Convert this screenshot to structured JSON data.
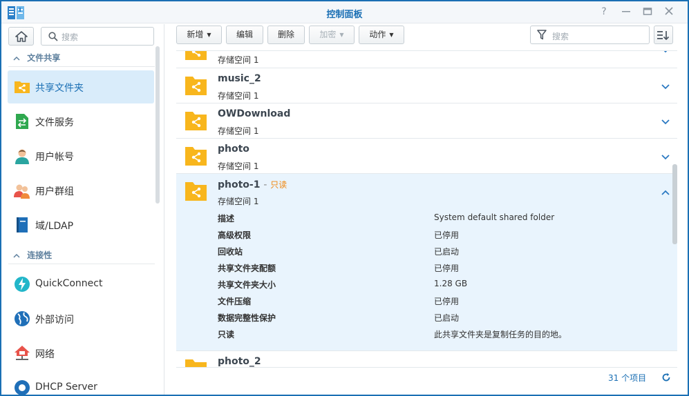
{
  "window": {
    "title": "控制面板"
  },
  "sidebar": {
    "search_placeholder": "搜索",
    "sections": [
      {
        "title": "文件共享"
      },
      {
        "title": "连接性"
      }
    ],
    "items": [
      {
        "label": "共享文件夹",
        "icon": "shared-folder-icon"
      },
      {
        "label": "文件服务",
        "icon": "file-services-icon"
      },
      {
        "label": "用户帐号",
        "icon": "user-icon"
      },
      {
        "label": "用户群组",
        "icon": "group-icon"
      },
      {
        "label": "域/LDAP",
        "icon": "domain-ldap-icon"
      },
      {
        "label": "QuickConnect",
        "icon": "quickconnect-icon"
      },
      {
        "label": "外部访问",
        "icon": "external-access-icon"
      },
      {
        "label": "网络",
        "icon": "network-icon"
      },
      {
        "label": "DHCP Server",
        "icon": "dhcp-server-icon"
      }
    ]
  },
  "toolbar": {
    "create": "新增",
    "edit": "编辑",
    "delete": "删除",
    "encrypt": "加密",
    "action": "动作",
    "filter_placeholder": "搜索"
  },
  "folders": [
    {
      "name": "",
      "volume": "存储空间 1"
    },
    {
      "name": "music_2",
      "volume": "存储空间 1"
    },
    {
      "name": "OWDownload",
      "volume": "存储空间 1"
    },
    {
      "name": "photo",
      "volume": "存储空间 1"
    },
    {
      "name": "photo-1",
      "volume": "存储空间 1",
      "readonly": "只读",
      "dash": "-"
    },
    {
      "name": "photo_2",
      "volume": ""
    }
  ],
  "details": [
    {
      "key": "描述",
      "value": "System default shared folder"
    },
    {
      "key": "高级权限",
      "value": "已停用"
    },
    {
      "key": "回收站",
      "value": "已启动"
    },
    {
      "key": "共享文件夹配额",
      "value": "已停用"
    },
    {
      "key": "共享文件夹大小",
      "value": "1.28 GB"
    },
    {
      "key": "文件压缩",
      "value": "已停用"
    },
    {
      "key": "数据完整性保护",
      "value": "已启动"
    },
    {
      "key": "只读",
      "value": "此共享文件夹是复制任务的目的地。"
    }
  ],
  "footer": {
    "count": "31 个项目"
  },
  "colors": {
    "accent": "#1a6fb4",
    "folder": "#f8b61d",
    "readonly": "#f0860d",
    "selected": "#d9ecfa"
  }
}
